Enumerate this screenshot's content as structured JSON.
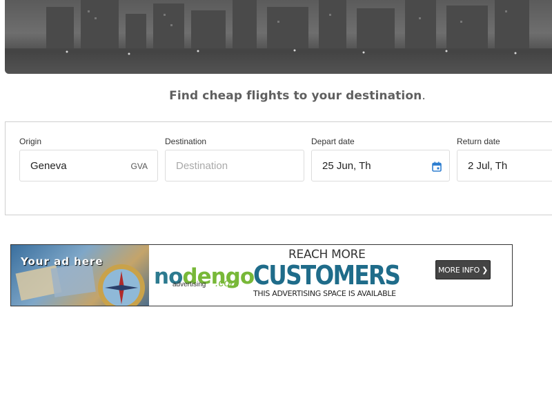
{
  "hero": {
    "image": "city skyline at night (grayscale)"
  },
  "tagline": {
    "text": "Find cheap flights to your destination",
    "punct": "."
  },
  "search": {
    "origin": {
      "label": "Origin",
      "value": "Geneva",
      "code": "GVA"
    },
    "destination": {
      "label": "Destination",
      "placeholder": "Destination",
      "value": ""
    },
    "depart": {
      "label": "Depart date",
      "value": "25 Jun, Th",
      "icon": "calendar-icon"
    },
    "return": {
      "label": "Return date",
      "value": "2 Jul, Th"
    }
  },
  "ad": {
    "your_ad": "Your ad here",
    "logo_no": "no",
    "logo_dengo": "dengo",
    "logo_sub": "advertising",
    "logo_com": ".com",
    "headline_top": "REACH MORE",
    "headline_main": "CUSTOMERS",
    "headline_sub": "THIS ADVERTISING SPACE IS AVAILABLE",
    "button": "MORE INFO ❯"
  },
  "colors": {
    "accent": "#1f6c8a",
    "green": "#78b838",
    "calendar_icon": "#2f7fd0"
  }
}
